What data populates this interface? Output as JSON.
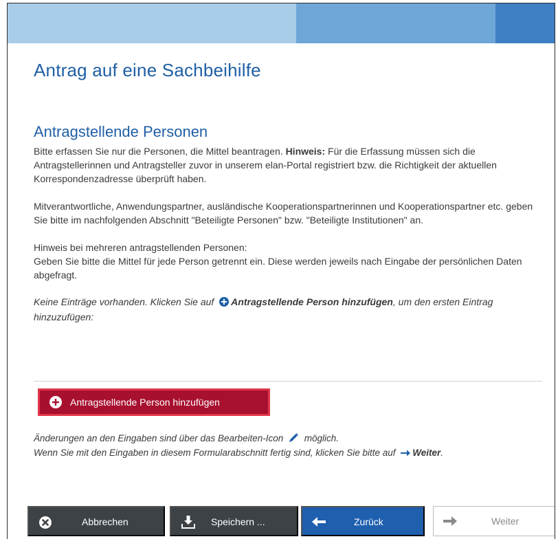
{
  "page": {
    "title": "Antrag auf eine Sachbeihilfe",
    "section_title": "Antragstellende Personen"
  },
  "intro": {
    "text_1": "Bitte erfassen Sie nur die Personen, die Mittel beantragen. ",
    "hint_label": "Hinweis:",
    "text_2": " Für die Erfassung müssen sich die Antragstellerinnen und Antragsteller zuvor in unserem elan-Portal registriert bzw. die Richtigkeit der aktuellen Korrespondenzadresse überprüft haben."
  },
  "paragraph_2": "Mitverantwortliche, Anwendungspartner, ausländische Kooperationspartnerinnen und Kooperationspartner etc. geben Sie bitte im nachfolgenden Abschnitt \"Beteiligte Personen\" bzw. \"Beteiligte Institutionen\" an.",
  "paragraph_3": {
    "line_1": "Hinweis bei mehreren antragstellenden Personen:",
    "line_2": "Geben Sie bitte die Mittel für jede Person getrennt ein. Diese werden jeweils nach Eingabe der persönlichen Daten abgefragt."
  },
  "empty_state": {
    "text_before": "Keine Einträge vorhanden. Klicken Sie auf ",
    "link_label": "Antragstellende Person hinzufügen",
    "text_after": ", um den ersten Eintrag hinzuzufügen:"
  },
  "add_button": {
    "label": "Antragstellende Person hinzufügen",
    "icon": "plus-circle-icon"
  },
  "notes": {
    "line_1_before": "Änderungen an den Eingaben sind über das Bearbeiten-Icon ",
    "line_1_after": " möglich.",
    "line_2_before": "Wenn Sie mit den Eingaben in diesem Formularabschnitt fertig sind, klicken Sie bitte auf ",
    "line_2_link": "Weiter",
    "line_2_after": "."
  },
  "footer": {
    "cancel_label": "Abbrechen",
    "save_label": "Speichern ...",
    "back_label": "Zurück",
    "next_label": "Weiter"
  },
  "colors": {
    "heading_blue": "#1f5fa6",
    "add_button_bg": "#a8102f",
    "add_button_border": "#e0364a",
    "dark_button_bg": "#3d4246",
    "back_button_bg": "#1e5fae",
    "disabled_text": "#8a8a8a"
  }
}
